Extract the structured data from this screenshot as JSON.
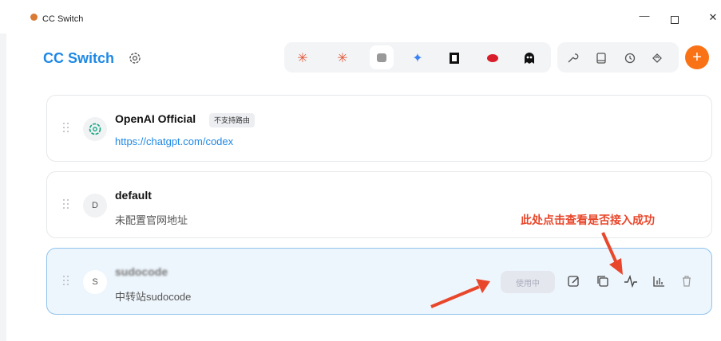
{
  "window": {
    "title": "CC Switch",
    "minimize": "—",
    "close": "✕"
  },
  "header": {
    "app_title": "CC Switch",
    "add_label": "+"
  },
  "providers": [
    {
      "name": "OpenAI Official",
      "badge": "不支持路由",
      "subtitle": "https://chatgpt.com/codex",
      "avatar": ""
    },
    {
      "name": "default",
      "subtitle": "未配置官网地址",
      "avatar": "D"
    },
    {
      "name": "sudocode",
      "subtitle": "中转站sudocode",
      "avatar": "S",
      "status_button": "使用中"
    }
  ],
  "annotation": {
    "text": "此处点击查看是否接入成功"
  }
}
